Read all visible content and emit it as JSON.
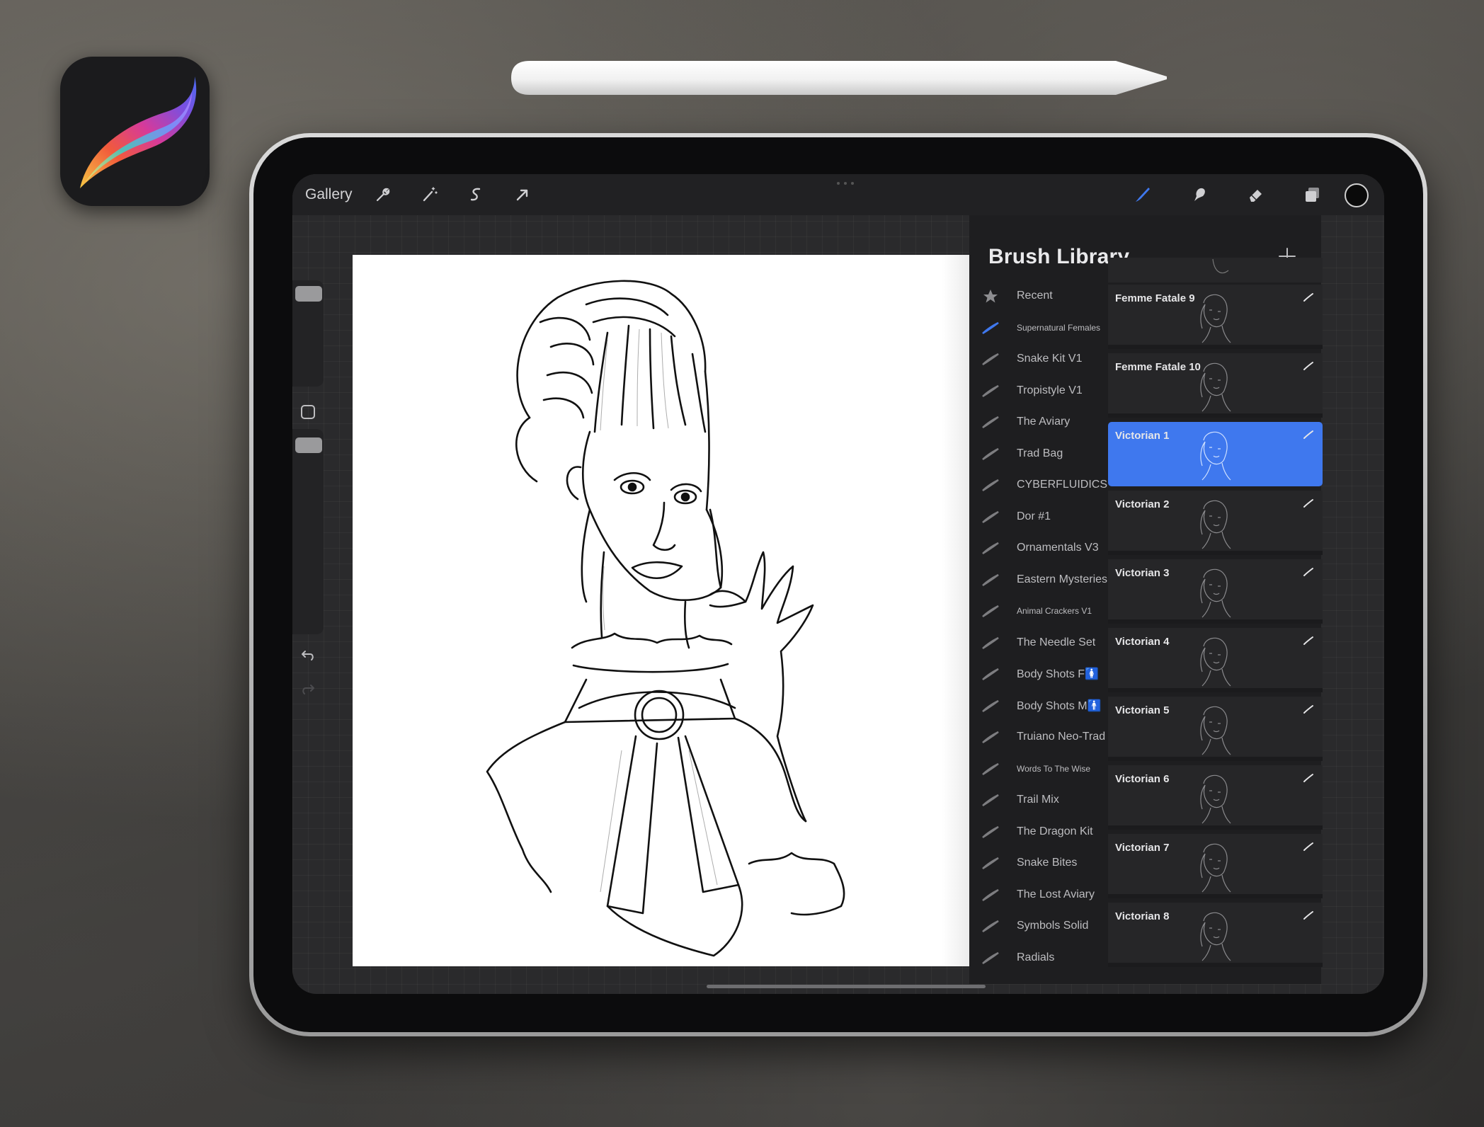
{
  "toolbar": {
    "gallery_label": "Gallery",
    "tools": [
      {
        "icon": "wrench-icon"
      },
      {
        "icon": "magic-wand-icon"
      },
      {
        "icon": "selection-icon"
      },
      {
        "icon": "transform-arrow-icon"
      }
    ],
    "right_tools": [
      {
        "icon": "brush-icon",
        "active": true
      },
      {
        "icon": "smudge-icon"
      },
      {
        "icon": "eraser-icon"
      },
      {
        "icon": "layers-icon"
      }
    ],
    "color": "#0a0a0a"
  },
  "colors": {
    "accent": "#3f78ee",
    "panel": "#1e1e20"
  },
  "brush_library": {
    "title": "Brush Library",
    "sets": [
      {
        "label": "Recent",
        "icon": "star-icon"
      },
      {
        "label": "Supernatural Females",
        "small": true,
        "active": true
      },
      {
        "label": "Snake Kit V1"
      },
      {
        "label": "Tropistyle V1"
      },
      {
        "label": "The Aviary"
      },
      {
        "label": "Trad Bag"
      },
      {
        "label": "CYBERFLUIDICS II"
      },
      {
        "label": "Dor #1"
      },
      {
        "label": "Ornamentals V3"
      },
      {
        "label": "Eastern Mysteries"
      },
      {
        "label": "Animal Crackers V1",
        "small": true
      },
      {
        "label": "The Needle Set"
      },
      {
        "label": "Body Shots F🚺"
      },
      {
        "label": "Body Shots M🚹"
      },
      {
        "label": "Truiano Neo-Trad"
      },
      {
        "label": "Words To The Wise",
        "small": true
      },
      {
        "label": "Trail Mix"
      },
      {
        "label": "The Dragon Kit"
      },
      {
        "label": "Snake Bites"
      },
      {
        "label": "The Lost Aviary"
      },
      {
        "label": "Symbols Solid"
      },
      {
        "label": "Radials"
      }
    ],
    "brushes": [
      {
        "name": "Femme Fatale 9"
      },
      {
        "name": "Femme Fatale 10"
      },
      {
        "name": "Victorian 1",
        "active": true
      },
      {
        "name": "Victorian 2"
      },
      {
        "name": "Victorian 3"
      },
      {
        "name": "Victorian 4"
      },
      {
        "name": "Victorian 5"
      },
      {
        "name": "Victorian 6"
      },
      {
        "name": "Victorian 7"
      },
      {
        "name": "Victorian 8"
      }
    ]
  }
}
